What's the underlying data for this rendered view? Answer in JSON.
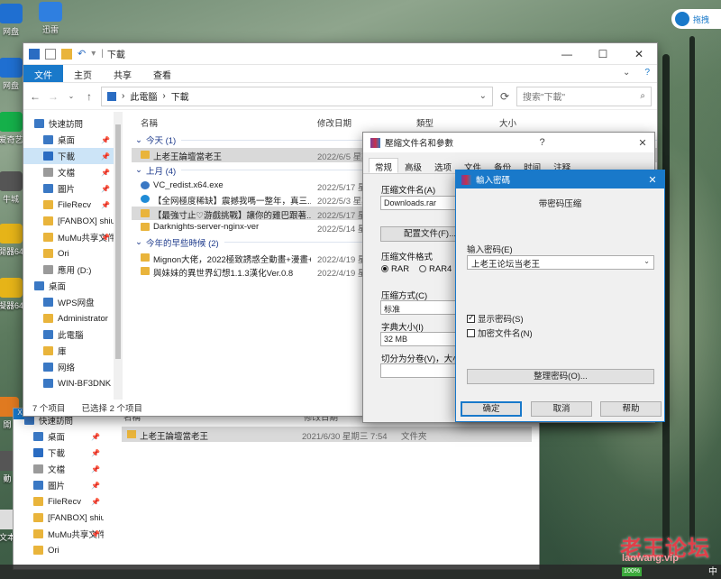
{
  "desktop": {
    "icons": [
      {
        "label": "网盘",
        "color": "#1f6fd1"
      },
      {
        "label": "迅雷",
        "color": "#2f7fe0"
      },
      {
        "label": "网盘",
        "color": "#1f6fd1"
      },
      {
        "label": "爱奇艺",
        "color": "#15b04a"
      },
      {
        "label": "牛城",
        "color": "#555555"
      },
      {
        "label": "開器64",
        "color": "#e6b418"
      },
      {
        "label": "擬器64",
        "color": "#e6b418"
      },
      {
        "label": "開",
        "color": "#e07a20"
      },
      {
        "label": "動",
        "color": "#555555"
      },
      {
        "label": "文本",
        "color": "#dddddd"
      }
    ],
    "pill_label": "拖拽"
  },
  "explorer": {
    "title": "下載",
    "ribbon_tabs": [
      "文件",
      "主页",
      "共享",
      "查看"
    ],
    "address": [
      "此電腦",
      "下載"
    ],
    "search_placeholder": "搜索\"下載\"",
    "sidebar": [
      {
        "label": "快速訪問",
        "icon": "star-icon",
        "child": false,
        "pin": false,
        "selected": false
      },
      {
        "label": "桌面",
        "icon": "folder-blue-icon",
        "child": true,
        "pin": true,
        "selected": false
      },
      {
        "label": "下載",
        "icon": "download-icon",
        "child": true,
        "pin": true,
        "selected": true
      },
      {
        "label": "文檔",
        "icon": "document-icon",
        "child": true,
        "pin": true,
        "selected": false
      },
      {
        "label": "圖片",
        "icon": "picture-icon",
        "child": true,
        "pin": true,
        "selected": false
      },
      {
        "label": "FileRecv",
        "icon": "folder-icon",
        "child": true,
        "pin": true,
        "selected": false
      },
      {
        "label": "[FANBOX] shiu",
        "icon": "folder-icon",
        "child": true,
        "pin": false,
        "selected": false
      },
      {
        "label": "MuMu共享文件",
        "icon": "folder-icon",
        "child": true,
        "pin": true,
        "selected": false
      },
      {
        "label": "Ori",
        "icon": "folder-icon",
        "child": true,
        "pin": false,
        "selected": false
      },
      {
        "label": "應用 (D:)",
        "icon": "drive-icon",
        "child": true,
        "pin": false,
        "selected": false
      },
      {
        "label": "桌面",
        "icon": "folder-blue-icon",
        "child": false,
        "pin": false,
        "selected": false
      },
      {
        "label": "WPS网盘",
        "icon": "cloud-icon",
        "child": true,
        "pin": false,
        "selected": false
      },
      {
        "label": "Administrator",
        "icon": "user-icon",
        "child": true,
        "pin": false,
        "selected": false
      },
      {
        "label": "此電腦",
        "icon": "computer-icon",
        "child": true,
        "pin": false,
        "selected": false
      },
      {
        "label": "庫",
        "icon": "library-icon",
        "child": true,
        "pin": false,
        "selected": false
      },
      {
        "label": "网络",
        "icon": "network-icon",
        "child": true,
        "pin": false,
        "selected": false
      },
      {
        "label": "WIN-BF3DNK",
        "icon": "computer-icon",
        "child": true,
        "pin": false,
        "selected": false
      }
    ],
    "columns": {
      "name": "名稱",
      "modified": "修改日期",
      "type": "類型",
      "size": "大小"
    },
    "groups": [
      {
        "label": "今天 (1)",
        "rows": [
          {
            "name": "上老王論壇當老王",
            "date": "2022/6/5 星期",
            "icon": "folder-icon",
            "selected": true
          }
        ]
      },
      {
        "label": "上月 (4)",
        "rows": [
          {
            "name": "VC_redist.x64.exe",
            "date": "2022/5/17 星期",
            "icon": "exe-icon",
            "selected": false
          },
          {
            "name": "【全网極度稀缺】震撼我嗎一整年，真三...",
            "date": "2022/5/3 星期",
            "icon": "edge-icon",
            "selected": false
          },
          {
            "name": "【最強寸止♡游戲挑戰】讓你的雞巴跟著...",
            "date": "2022/5/17 星期",
            "icon": "folder-icon",
            "selected": true
          },
          {
            "name": "Darknights-server-nginx-ver",
            "date": "2022/5/14 星期",
            "icon": "folder-icon",
            "selected": false
          }
        ]
      },
      {
        "label": "今年的早些時候 (2)",
        "rows": [
          {
            "name": "Mignon大佬，2022極致誘惑全動畫+漫畫+...",
            "date": "2022/4/19 星期",
            "icon": "folder-icon",
            "selected": false
          },
          {
            "name": "與妹妹的異世界幻想1.1.3漢化Ver.0.8",
            "date": "2022/4/19 星期",
            "icon": "folder-icon",
            "selected": false
          }
        ]
      }
    ],
    "status_count": "7 个项目",
    "status_selected": "已选择 2 个项目"
  },
  "explorer2": {
    "sidebar": [
      {
        "label": "快速訪問",
        "pin": false
      },
      {
        "label": "桌面",
        "pin": true
      },
      {
        "label": "下載",
        "pin": true
      },
      {
        "label": "文檔",
        "pin": true
      },
      {
        "label": "圖片",
        "pin": true
      },
      {
        "label": "FileRecv",
        "pin": true
      },
      {
        "label": "[FANBOX] shiu",
        "pin": false
      },
      {
        "label": "MuMu共享文件",
        "pin": true
      },
      {
        "label": "Ori",
        "pin": false
      }
    ],
    "col_name": "名稱",
    "col_modified": "修改日期",
    "row": {
      "name": "上老王論壇當老王",
      "date": "2021/6/30 星期三 7:54",
      "type": "文件夾"
    }
  },
  "rar": {
    "title": "壓縮文件名和參數",
    "tabs": [
      "常规",
      "高级",
      "选项",
      "文件",
      "备份",
      "时间",
      "注释"
    ],
    "archive_name_label": "压缩文件名(A)",
    "archive_name_value": "Downloads.rar",
    "profile_button": "配置文件(F)...",
    "format_label": "压缩文件格式",
    "format_options": [
      "RAR",
      "RAR4"
    ],
    "method_label": "压缩方式(C)",
    "method_value": "标准",
    "dict_label": "字典大小(I)",
    "dict_value": "32 MB",
    "split_label": "切分为分卷(V)，大小"
  },
  "password": {
    "title": "輸入密碼",
    "heading": "带密码压缩",
    "input_label": "输入密码(E)",
    "input_value": "上老王论坛当老王",
    "show_password_label": "显示密码(S)",
    "show_password_checked": true,
    "encrypt_names_label": "加密文件名(N)",
    "encrypt_names_checked": false,
    "organize_button": "整理密码(O)...",
    "ok_button": "确定",
    "cancel_button": "取消",
    "help_button": "帮助"
  },
  "watermark": {
    "main": "老王论坛",
    "sub": "laowang.vip"
  },
  "taskbar": {
    "battery": "100%",
    "ime": "中"
  }
}
